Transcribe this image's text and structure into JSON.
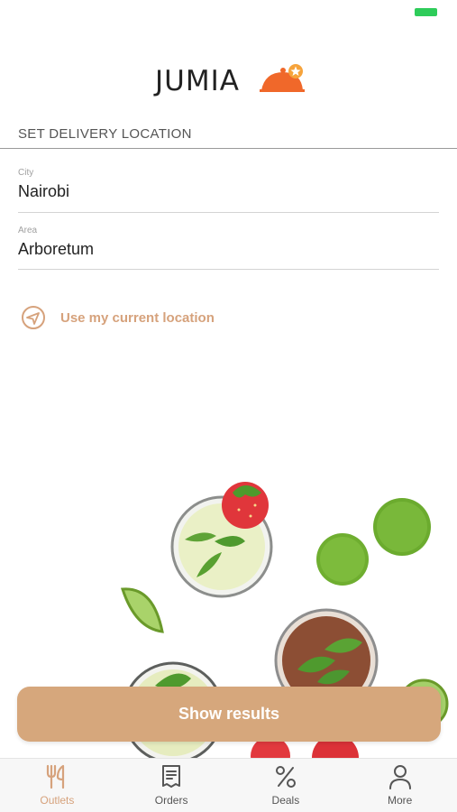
{
  "brand": {
    "name": "JUMIA"
  },
  "location": {
    "title": "SET DELIVERY LOCATION",
    "city": {
      "label": "City",
      "value": "Nairobi"
    },
    "area": {
      "label": "Area",
      "value": "Arboretum"
    },
    "use_current": "Use my current location"
  },
  "actions": {
    "show_results": "Show results"
  },
  "tabs": [
    {
      "label": "Outlets",
      "icon": "fork-knife-icon",
      "active": true
    },
    {
      "label": "Orders",
      "icon": "receipt-icon",
      "active": false
    },
    {
      "label": "Deals",
      "icon": "percent-icon",
      "active": false
    },
    {
      "label": "More",
      "icon": "person-icon",
      "active": false
    }
  ],
  "colors": {
    "accent": "#d6a77c",
    "accent_text": "#d6a27c",
    "brand_orange": "#f0682a",
    "status_green": "#2ecc5a"
  }
}
